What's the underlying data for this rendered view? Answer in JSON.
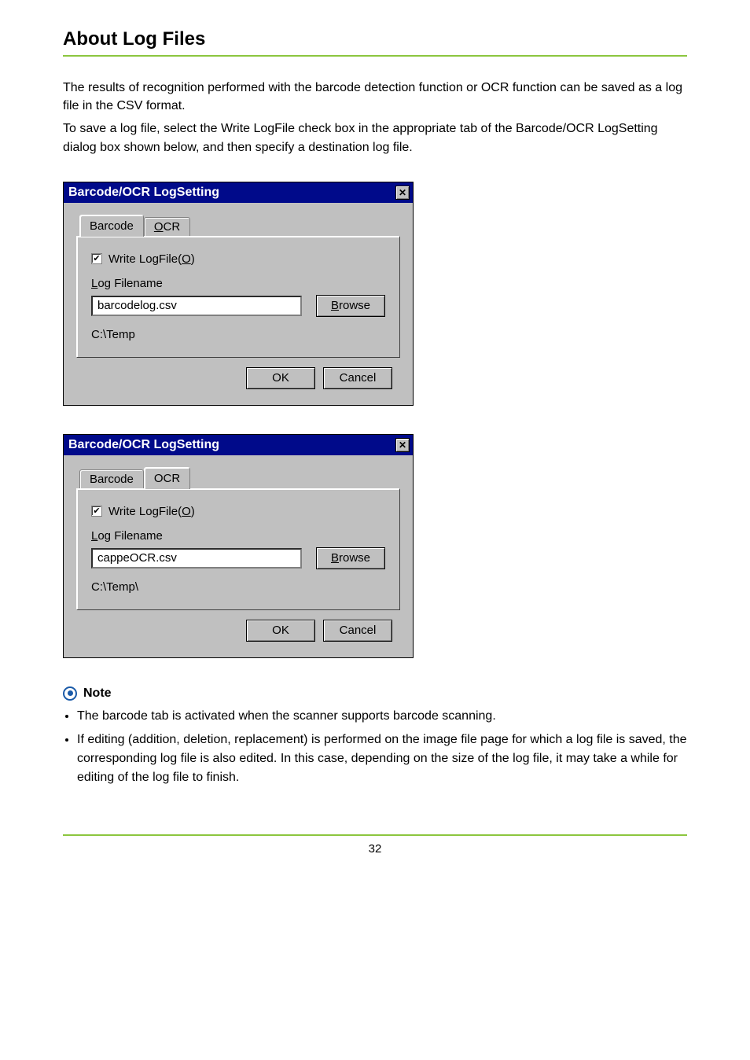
{
  "page": {
    "title": "About Log Files",
    "intro1": "The results of recognition performed with the barcode detection function or OCR function can be saved as a log file in the CSV format.",
    "intro2": "To save a log file, select the Write LogFile check box in the appropriate tab of the Barcode/OCR LogSetting dialog box shown below, and then specify a destination log file.",
    "page_number": "32"
  },
  "dialog1": {
    "title": "Barcode/OCR LogSetting",
    "tabs": {
      "barcode": "Barcode",
      "ocr_prefix": "O",
      "ocr_rest": "CR"
    },
    "active_tab": "barcode",
    "checkbox_label_prefix": "Write LogFile(",
    "checkbox_label_key": "O",
    "checkbox_label_suffix": ")",
    "checked": true,
    "log_label_prefix": "L",
    "log_label_rest": "og Filename",
    "filename": "barcodelog.csv",
    "browse_prefix": "B",
    "browse_rest": "rowse",
    "path": "C:\\Temp",
    "ok": "OK",
    "cancel": "Cancel"
  },
  "dialog2": {
    "title": "Barcode/OCR LogSetting",
    "tabs": {
      "barcode": "Barcode",
      "ocr": "OCR"
    },
    "active_tab": "ocr",
    "checkbox_label_prefix": "Write LogFile(",
    "checkbox_label_key": "O",
    "checkbox_label_suffix": ")",
    "checked": true,
    "log_label_prefix": "L",
    "log_label_rest": "og Filename",
    "filename": "cappeOCR.csv",
    "browse_prefix": "B",
    "browse_rest": "rowse",
    "path": "C:\\Temp\\",
    "ok": "OK",
    "cancel": "Cancel"
  },
  "note": {
    "heading": "Note",
    "items": [
      "The barcode tab is activated when the scanner supports barcode scanning.",
      "If editing (addition, deletion, replacement) is performed on the image file page for which a log file is saved, the corresponding log file is also edited. In this case, depending on the size of the log file, it may take a while for editing of the log file to finish."
    ]
  }
}
